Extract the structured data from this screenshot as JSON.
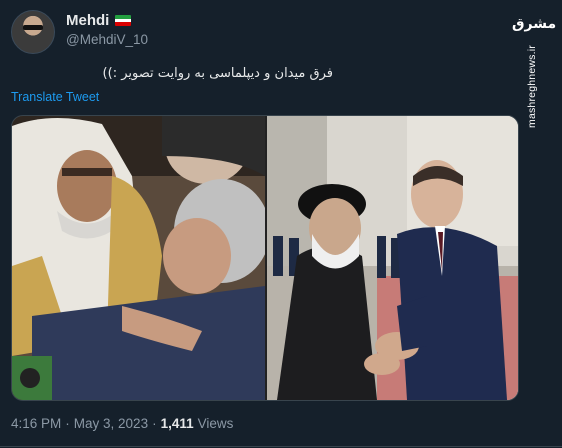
{
  "author": {
    "name": "Mehdi",
    "handle": "@MehdiV_10",
    "flag_icon": "iran-flag-icon"
  },
  "tweet": {
    "text": "فرق میدان و دیپلماسی به روایت تصویر :))",
    "translate_label": "Translate Tweet"
  },
  "watermark": {
    "logo": "مشرق",
    "url": "mashreghnews.ir"
  },
  "meta": {
    "time": "4:16 PM",
    "sep1": "·",
    "date": "May 3, 2023",
    "sep2": "·",
    "views_count": "1,411",
    "views_label": "Views"
  },
  "colors": {
    "background": "#15202b",
    "link": "#1d9bf0",
    "secondary_text": "#8b98a5"
  }
}
